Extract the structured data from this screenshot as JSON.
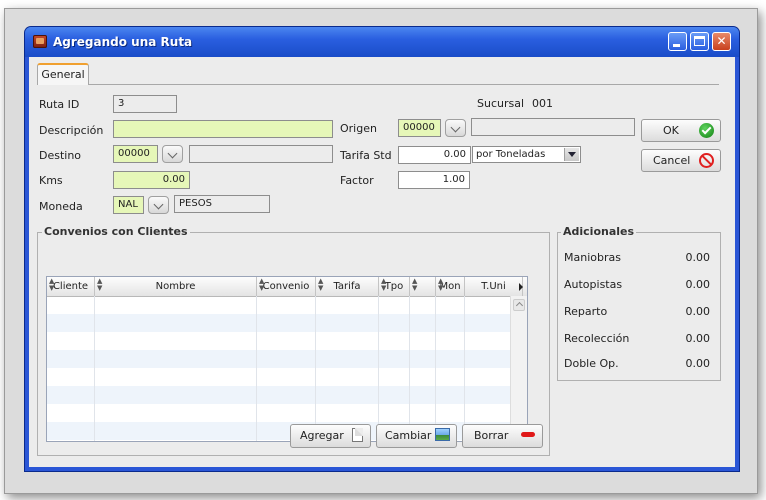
{
  "window": {
    "title": "Agregando una Ruta"
  },
  "tabs": [
    {
      "label": "General",
      "selected": true
    }
  ],
  "form": {
    "ruta_id_label": "Ruta ID",
    "ruta_id_value": "3",
    "sucursal_label": "Sucursal",
    "sucursal_value": "001",
    "descripcion_label": "Descripción",
    "descripcion_value": "",
    "origen_label": "Origen",
    "origen_code": "00000",
    "origen_name": "",
    "destino_label": "Destino",
    "destino_code": "00000",
    "destino_name": "",
    "tarifa_std_label": "Tarifa Std",
    "tarifa_std_value": "0.00",
    "tarifa_unit_selected": "por Toneladas",
    "kms_label": "Kms",
    "kms_value": "0.00",
    "factor_label": "Factor",
    "factor_value": "1.00",
    "moneda_label": "Moneda",
    "moneda_code": "NAL",
    "moneda_name": "PESOS"
  },
  "actions": {
    "ok_label": "OK",
    "cancel_label": "Cancel"
  },
  "convenios": {
    "title": "Convenios con Clientes",
    "columns": [
      "Cliente",
      "Nombre",
      "Convenio",
      "Tarifa",
      "Tpo",
      "",
      "Mon",
      "T.Uni"
    ],
    "rows": [],
    "agregar_label": "Agregar",
    "cambiar_label": "Cambiar",
    "borrar_label": "Borrar"
  },
  "adicionales": {
    "title": "Adicionales",
    "items": [
      {
        "label": "Maniobras",
        "value": "0.00"
      },
      {
        "label": "Autopistas",
        "value": "0.00"
      },
      {
        "label": "Reparto",
        "value": "0.00"
      },
      {
        "label": "Recolección",
        "value": "0.00"
      },
      {
        "label": "Doble Op.",
        "value": "0.00"
      }
    ]
  },
  "colors": {
    "title_bar": "#2a5fe0",
    "required_field": "#e6f7b8",
    "alt_row": "#eef4fb",
    "ok_green": "#128012",
    "cancel_red": "#e02020"
  }
}
